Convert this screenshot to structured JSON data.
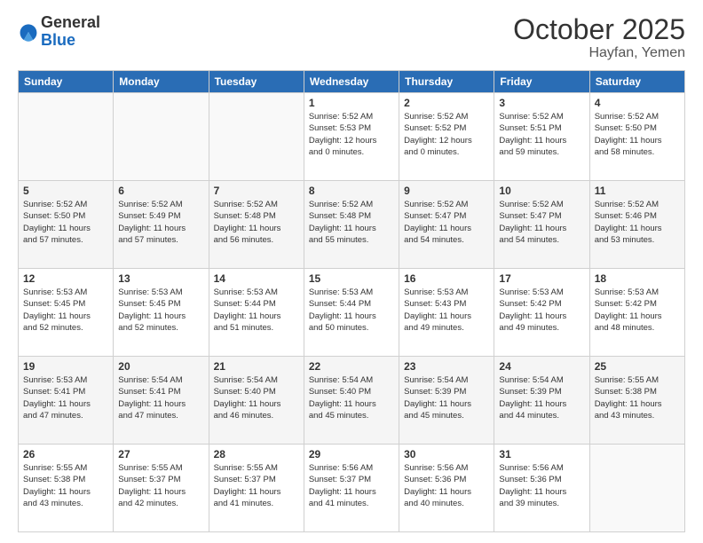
{
  "logo": {
    "general": "General",
    "blue": "Blue"
  },
  "title": "October 2025",
  "location": "Hayfan, Yemen",
  "days_of_week": [
    "Sunday",
    "Monday",
    "Tuesday",
    "Wednesday",
    "Thursday",
    "Friday",
    "Saturday"
  ],
  "weeks": [
    [
      {
        "num": "",
        "info": ""
      },
      {
        "num": "",
        "info": ""
      },
      {
        "num": "",
        "info": ""
      },
      {
        "num": "1",
        "info": "Sunrise: 5:52 AM\nSunset: 5:53 PM\nDaylight: 12 hours\nand 0 minutes."
      },
      {
        "num": "2",
        "info": "Sunrise: 5:52 AM\nSunset: 5:52 PM\nDaylight: 12 hours\nand 0 minutes."
      },
      {
        "num": "3",
        "info": "Sunrise: 5:52 AM\nSunset: 5:51 PM\nDaylight: 11 hours\nand 59 minutes."
      },
      {
        "num": "4",
        "info": "Sunrise: 5:52 AM\nSunset: 5:50 PM\nDaylight: 11 hours\nand 58 minutes."
      }
    ],
    [
      {
        "num": "5",
        "info": "Sunrise: 5:52 AM\nSunset: 5:50 PM\nDaylight: 11 hours\nand 57 minutes."
      },
      {
        "num": "6",
        "info": "Sunrise: 5:52 AM\nSunset: 5:49 PM\nDaylight: 11 hours\nand 57 minutes."
      },
      {
        "num": "7",
        "info": "Sunrise: 5:52 AM\nSunset: 5:48 PM\nDaylight: 11 hours\nand 56 minutes."
      },
      {
        "num": "8",
        "info": "Sunrise: 5:52 AM\nSunset: 5:48 PM\nDaylight: 11 hours\nand 55 minutes."
      },
      {
        "num": "9",
        "info": "Sunrise: 5:52 AM\nSunset: 5:47 PM\nDaylight: 11 hours\nand 54 minutes."
      },
      {
        "num": "10",
        "info": "Sunrise: 5:52 AM\nSunset: 5:47 PM\nDaylight: 11 hours\nand 54 minutes."
      },
      {
        "num": "11",
        "info": "Sunrise: 5:52 AM\nSunset: 5:46 PM\nDaylight: 11 hours\nand 53 minutes."
      }
    ],
    [
      {
        "num": "12",
        "info": "Sunrise: 5:53 AM\nSunset: 5:45 PM\nDaylight: 11 hours\nand 52 minutes."
      },
      {
        "num": "13",
        "info": "Sunrise: 5:53 AM\nSunset: 5:45 PM\nDaylight: 11 hours\nand 52 minutes."
      },
      {
        "num": "14",
        "info": "Sunrise: 5:53 AM\nSunset: 5:44 PM\nDaylight: 11 hours\nand 51 minutes."
      },
      {
        "num": "15",
        "info": "Sunrise: 5:53 AM\nSunset: 5:44 PM\nDaylight: 11 hours\nand 50 minutes."
      },
      {
        "num": "16",
        "info": "Sunrise: 5:53 AM\nSunset: 5:43 PM\nDaylight: 11 hours\nand 49 minutes."
      },
      {
        "num": "17",
        "info": "Sunrise: 5:53 AM\nSunset: 5:42 PM\nDaylight: 11 hours\nand 49 minutes."
      },
      {
        "num": "18",
        "info": "Sunrise: 5:53 AM\nSunset: 5:42 PM\nDaylight: 11 hours\nand 48 minutes."
      }
    ],
    [
      {
        "num": "19",
        "info": "Sunrise: 5:53 AM\nSunset: 5:41 PM\nDaylight: 11 hours\nand 47 minutes."
      },
      {
        "num": "20",
        "info": "Sunrise: 5:54 AM\nSunset: 5:41 PM\nDaylight: 11 hours\nand 47 minutes."
      },
      {
        "num": "21",
        "info": "Sunrise: 5:54 AM\nSunset: 5:40 PM\nDaylight: 11 hours\nand 46 minutes."
      },
      {
        "num": "22",
        "info": "Sunrise: 5:54 AM\nSunset: 5:40 PM\nDaylight: 11 hours\nand 45 minutes."
      },
      {
        "num": "23",
        "info": "Sunrise: 5:54 AM\nSunset: 5:39 PM\nDaylight: 11 hours\nand 45 minutes."
      },
      {
        "num": "24",
        "info": "Sunrise: 5:54 AM\nSunset: 5:39 PM\nDaylight: 11 hours\nand 44 minutes."
      },
      {
        "num": "25",
        "info": "Sunrise: 5:55 AM\nSunset: 5:38 PM\nDaylight: 11 hours\nand 43 minutes."
      }
    ],
    [
      {
        "num": "26",
        "info": "Sunrise: 5:55 AM\nSunset: 5:38 PM\nDaylight: 11 hours\nand 43 minutes."
      },
      {
        "num": "27",
        "info": "Sunrise: 5:55 AM\nSunset: 5:37 PM\nDaylight: 11 hours\nand 42 minutes."
      },
      {
        "num": "28",
        "info": "Sunrise: 5:55 AM\nSunset: 5:37 PM\nDaylight: 11 hours\nand 41 minutes."
      },
      {
        "num": "29",
        "info": "Sunrise: 5:56 AM\nSunset: 5:37 PM\nDaylight: 11 hours\nand 41 minutes."
      },
      {
        "num": "30",
        "info": "Sunrise: 5:56 AM\nSunset: 5:36 PM\nDaylight: 11 hours\nand 40 minutes."
      },
      {
        "num": "31",
        "info": "Sunrise: 5:56 AM\nSunset: 5:36 PM\nDaylight: 11 hours\nand 39 minutes."
      },
      {
        "num": "",
        "info": ""
      }
    ]
  ]
}
